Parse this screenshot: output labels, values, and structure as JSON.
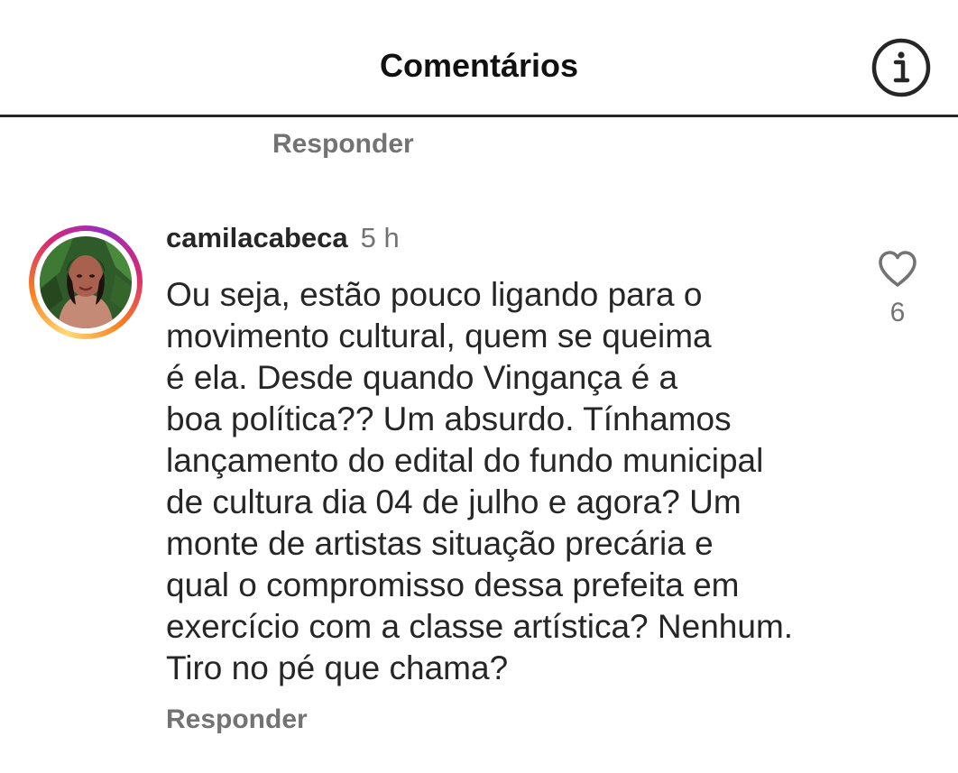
{
  "header": {
    "title": "Comentários",
    "info_icon": "info-circle-icon"
  },
  "previous_comment": {
    "reply_label": "Responder"
  },
  "comment": {
    "username": "camilacabeca",
    "time": "5 h",
    "text": "Ou seja,  estão pouco ligando para o\nmovimento cultural,  quem se queima\né ela. Desde quando Vingança é a\nboa política?? Um absurdo. Tínhamos\nlançamento do edital do fundo municipal\nde cultura dia 04 de julho e agora? Um\nmonte de artistas  situação precária e\nqual o compromisso dessa prefeita em\nexercício com a classe artística? Nenhum.\nTiro no pé que chama?",
    "reply_label": "Responder",
    "like_icon": "heart-outline-icon",
    "like_count": "6"
  },
  "colors": {
    "text_primary": "#262626",
    "text_secondary": "#737373",
    "divider": "#262626",
    "story_ring_start": "#feda75",
    "story_ring_mid": "#d62976",
    "story_ring_end": "#962fbf"
  }
}
